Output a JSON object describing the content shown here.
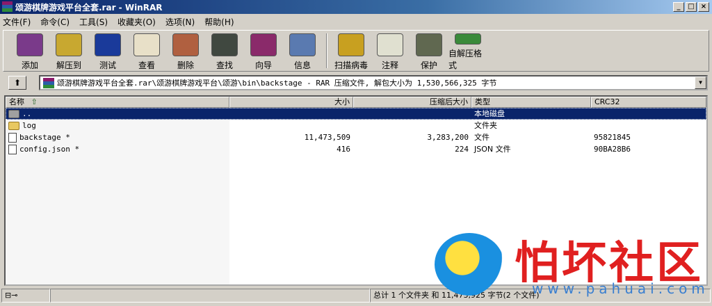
{
  "title": "颂游棋牌游戏平台全套.rar - WinRAR",
  "window_buttons": [
    "_",
    "□",
    "×"
  ],
  "menu": [
    "文件(F)",
    "命令(C)",
    "工具(S)",
    "收藏夹(O)",
    "选项(N)",
    "帮助(H)"
  ],
  "toolbar": [
    {
      "label": "添加",
      "icon": "add-archive-icon",
      "color": "#7a3a8a"
    },
    {
      "label": "解压到",
      "icon": "extract-to-icon",
      "color": "#c8a830"
    },
    {
      "label": "测试",
      "icon": "test-icon",
      "color": "#1a3a9a"
    },
    {
      "label": "查看",
      "icon": "view-icon",
      "color": "#e8e0c8"
    },
    {
      "label": "删除",
      "icon": "delete-icon",
      "color": "#b06040"
    },
    {
      "label": "查找",
      "icon": "find-icon",
      "color": "#404840"
    },
    {
      "label": "向导",
      "icon": "wizard-icon",
      "color": "#8a2a6a"
    },
    {
      "label": "信息",
      "icon": "info-icon",
      "color": "#5a7ab0"
    },
    {
      "label": "扫描病毒",
      "icon": "virus-scan-icon",
      "color": "#c8a020"
    },
    {
      "label": "注释",
      "icon": "comment-icon",
      "color": "#e0e0d0"
    },
    {
      "label": "保护",
      "icon": "protect-icon",
      "color": "#606850"
    },
    {
      "label": "自解压格式",
      "icon": "sfx-icon",
      "color": "#3a8a3a"
    }
  ],
  "address": {
    "up": "⬆",
    "path": "颂游棋牌游戏平台全套.rar\\颂游棋牌游戏平台\\颂游\\bin\\backstage - RAR 压缩文件, 解包大小为 1,530,566,325 字节",
    "dropdown": "▼"
  },
  "columns": {
    "name": "名称",
    "sort": "⇧",
    "size": "大小",
    "packed": "压缩后大小",
    "type": "类型",
    "crc": "CRC32"
  },
  "rows": [
    {
      "name": "..",
      "size": "",
      "packed": "",
      "type": "本地磁盘",
      "crc": "",
      "icon": "parent-folder-icon"
    },
    {
      "name": "log",
      "size": "",
      "packed": "",
      "type": "文件夹",
      "crc": "",
      "icon": "folder-icon"
    },
    {
      "name": "backstage *",
      "size": "11,473,509",
      "packed": "3,283,200",
      "type": "文件",
      "crc": "95821845",
      "icon": "file-icon"
    },
    {
      "name": "config.json *",
      "size": "416",
      "packed": "224",
      "type": "JSON 文件",
      "crc": "90BA28B6",
      "icon": "file-icon"
    }
  ],
  "status": {
    "icons": "⊟⊸",
    "summary": "总计 1 个文件夹 和 11,473,925 字节(2 个文件)"
  },
  "watermark": {
    "name": "怕坏社区",
    "url": "www.pahuai.com"
  }
}
